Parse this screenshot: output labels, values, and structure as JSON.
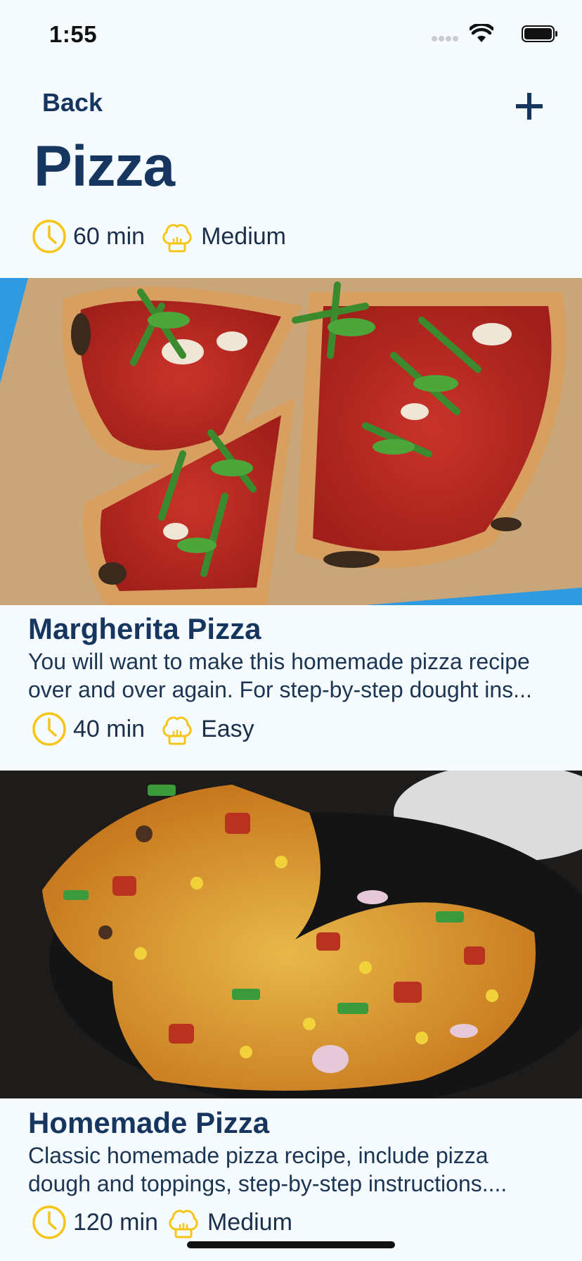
{
  "status": {
    "time": "1:55"
  },
  "nav": {
    "back_label": "Back",
    "title": "Pizza"
  },
  "partial_card": {
    "time": "60 min",
    "difficulty": "Medium"
  },
  "recipes": [
    {
      "title": "Margherita Pizza",
      "desc_line1": "You will want to make this homemade pizza recipe",
      "desc_line2": "over and over again. For step-by-step dought ins...",
      "time": "40 min",
      "difficulty": "Easy"
    },
    {
      "title": "Homemade Pizza",
      "desc_line1": "Classic homemade pizza recipe, include pizza",
      "desc_line2": "dough and toppings, step-by-step instructions....",
      "time": "120 min",
      "difficulty": "Medium"
    }
  ],
  "colors": {
    "accent": "#16365f",
    "icon": "#f5c518",
    "background": "#f5fbff"
  }
}
